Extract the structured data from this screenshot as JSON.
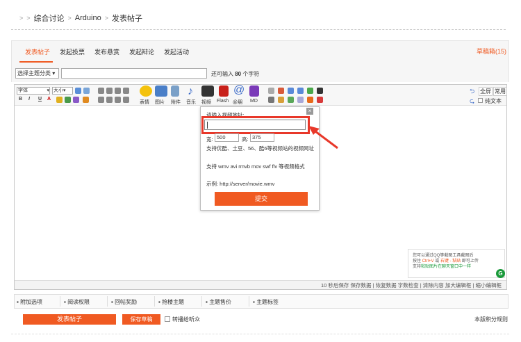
{
  "breadcrumb": {
    "sep": ">",
    "items": [
      "综合讨论",
      "Arduino",
      "发表帖子"
    ]
  },
  "tabs": [
    "发表帖子",
    "发起投票",
    "发布悬赏",
    "发起辩论",
    "发起活动"
  ],
  "draft_box": "草稿箱(15)",
  "subject": {
    "category": "选择主题分类",
    "hint_prefix": "还可输入",
    "hint_count": "80",
    "hint_suffix": "个字符"
  },
  "toolbar": {
    "font_select": "字体",
    "size_select": "大小",
    "format_buttons": [
      "B",
      "I",
      "U",
      "A"
    ],
    "media_buttons": [
      "表情",
      "图片",
      "附件",
      "音乐",
      "视频",
      "Flash",
      "@朋",
      "MD"
    ],
    "right": {
      "fullscreen": "全屏",
      "common": "常用",
      "plain_text": "纯文本"
    }
  },
  "video_popup": {
    "title": "请输入视频地址:",
    "url_value": "",
    "width_label": "宽:",
    "width_value": "500",
    "height_label": "高:",
    "height_value": "375",
    "support_sites": "支持优酷、土豆、56、酷6等视频站的视频网址",
    "support_formats": "支持 wmv avi rmvb mov swf flv 等视频格式",
    "example": "示例: http://server/movie.wmv",
    "submit": "提交"
  },
  "tip": {
    "line1": "您可以通过QQ等截图工具截图后",
    "line2_a": "按住",
    "line2_key": "Ctrl+V",
    "line2_b": "或",
    "line2_c": "右键 - 粘贴",
    "line2_d": "即可上传",
    "line3_a": "支持",
    "line3_b": "粘贴图片在聊天窗口中一样",
    "badge": "G"
  },
  "status_bar": "10 秒后保存 保存数据 | 恢复数据    字数检查 | 清除内容    加大编辑框 | 缩小编辑框",
  "options": [
    "附加选项",
    "阅读权限",
    "回帖奖励",
    "抢楼主题",
    "主题售价",
    "主题标签"
  ],
  "buttons": {
    "post": "发表帖子",
    "save_draft": "保存草稿",
    "broadcast": "转播给听众",
    "rules": "本版积分规则"
  },
  "colors": {
    "accent": "#f05a22",
    "highlight": "#e8382a",
    "tip_green": "#1a9a3a"
  }
}
